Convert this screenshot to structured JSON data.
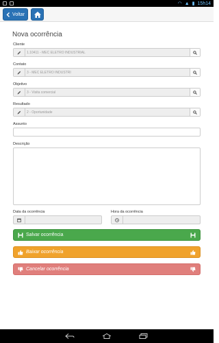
{
  "status_bar": {
    "time": "15h14"
  },
  "toolbar": {
    "back_label": "Voltar"
  },
  "page": {
    "title": "Nova ocorrência"
  },
  "form": {
    "cliente": {
      "label": "Cliente",
      "value": "1.10411 - MEC ELETRO INDUSTRIAL"
    },
    "contato": {
      "label": "Contato",
      "value": "3 - MEC ELETRO INDUSTRI"
    },
    "objetivo": {
      "label": "Objetivo",
      "value": "3 - Visita comercial"
    },
    "resultado": {
      "label": "Resultado",
      "value": "2 - Oportunidade"
    },
    "assunto": {
      "label": "Assunto",
      "value": ""
    },
    "descricao": {
      "label": "Descrição",
      "value": ""
    },
    "data": {
      "label": "Data da ocorrência",
      "value": ""
    },
    "hora": {
      "label": "Hora da ocorrência",
      "value": ""
    }
  },
  "actions": {
    "save": "Salvar ocorrência",
    "lower": "Baixar ocorrência",
    "cancel": "Cancelar ocorrência"
  },
  "colors": {
    "primary": "#2a72b5",
    "success": "#4aa84c",
    "warning": "#f0a22c",
    "danger": "#e07f7c"
  }
}
